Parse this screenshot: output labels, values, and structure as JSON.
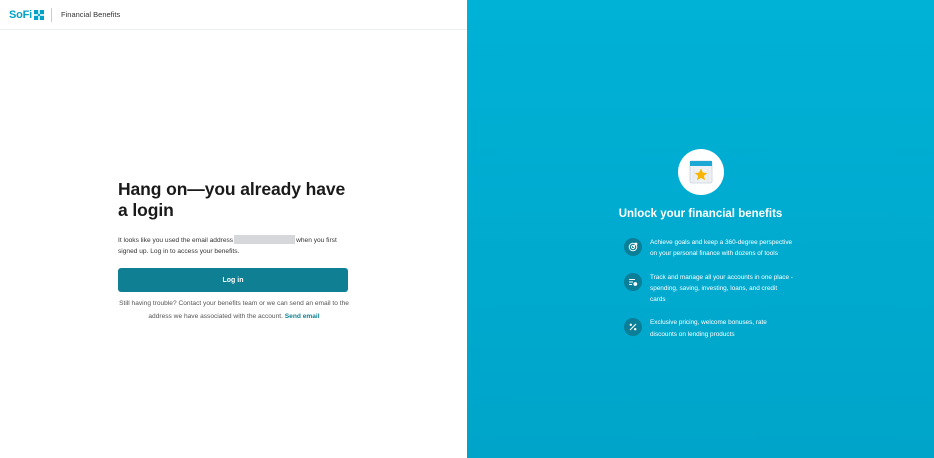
{
  "header": {
    "logo_text": "SoFi",
    "title": "Financial Benefits"
  },
  "main": {
    "headline": "Hang on—you already have a login",
    "body_before": "It looks like you used the email address",
    "body_after": "when you first signed up. Log in to access your benefits.",
    "login_label": "Log in",
    "trouble_text": "Still having trouble? Contact your benefits team or we can send an email to the address we have associated with the account.",
    "send_email_label": "Send email"
  },
  "panel": {
    "title": "Unlock your financial benefits",
    "features": [
      {
        "icon": "target-icon",
        "text": "Achieve goals and keep a 360-degree perspective on your personal finance with dozens of tools"
      },
      {
        "icon": "accounts-icon",
        "text": "Track and manage all your accounts in one place - spending, saving, investing, loans, and credit cards"
      },
      {
        "icon": "percent-icon",
        "text": "Exclusive pricing, welcome bonuses, rate discounts on lending products"
      }
    ]
  },
  "colors": {
    "brand": "#00a2c7",
    "button": "#0f7f93",
    "panel": "#00aacf"
  }
}
